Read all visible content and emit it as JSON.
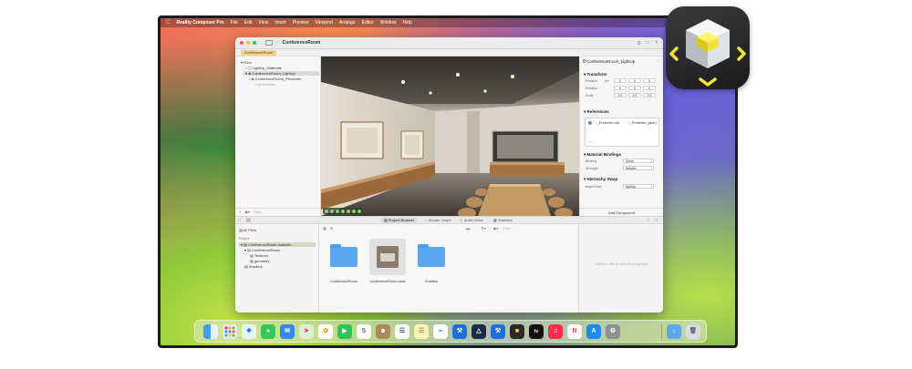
{
  "menubar": {
    "app_name": "Reality Composer Pro",
    "items": [
      "File",
      "Edit",
      "View",
      "Insert",
      "Preview",
      "Viewport",
      "Arrange",
      "Editor",
      "Window",
      "Help"
    ]
  },
  "window": {
    "title": "ConferenceRoom",
    "scene_tab": "ConferenceRoom"
  },
  "outline": {
    "items": [
      {
        "label": "Root"
      },
      {
        "label": "LightUp_Materials"
      },
      {
        "label": "ConferenceRoom_LightUp"
      },
      {
        "label": "ConferenceRoom_Presenter"
      },
      {
        "label": "LightHandler"
      }
    ],
    "filter_placeholder": "Filter"
  },
  "inspector": {
    "entity_name": "ConferenceRoom_LightUp",
    "transform": {
      "heading": "Transform",
      "position_label": "Position",
      "position_unit": "cm",
      "position": [
        "0",
        "0",
        "0"
      ],
      "rotation_label": "Rotation",
      "rotation": [
        "0",
        "0",
        "0"
      ],
      "scale_label": "Scale",
      "scale": [
        "0.0",
        "0.0",
        "0.0"
      ]
    },
    "references": {
      "heading": "References",
      "item1": "..._Presenter.usd",
      "item2": "..._Presenter_glow.j"
    },
    "material_bindings": {
      "heading": "Material Bindings",
      "binding_label": "Binding",
      "binding_value": "None",
      "strength_label": "Strength",
      "strength_value": "Weaker"
    },
    "hierarchy_swap": {
      "heading": "Hierarchy Swap",
      "target_label": "targetState",
      "target_value": "lightUp"
    },
    "add_component": "Add Component"
  },
  "bottom_tabs": [
    "Project Browser",
    "Shader Graph",
    "Audio Mixer",
    "Statistics"
  ],
  "project": {
    "all_files": "All Files",
    "section": "Project",
    "items": [
      {
        "label": "ConferenceRoom.rkassets"
      },
      {
        "label": "ConferenceRoom"
      },
      {
        "label": "Textures"
      },
      {
        "label": "geometry"
      },
      {
        "label": "Shaders"
      }
    ]
  },
  "files": {
    "filter_placeholder": "Filter",
    "tiles": [
      {
        "label": "ConferenceRoom",
        "icon": "folder-icon"
      },
      {
        "label": "ConferenceRoom.usda",
        "icon": "usd-file-icon"
      },
      {
        "label": "Shaders",
        "icon": "folder-icon"
      }
    ]
  },
  "preview": {
    "message": "Select a file to view its properties"
  },
  "dock": {
    "calendar_day": "5",
    "tv_label": "tv",
    "icons": [
      "finder-icon",
      "launchpad-icon",
      "safari-icon",
      "messages-icon",
      "mail-icon",
      "maps-icon",
      "photos-icon",
      "facetime-icon",
      "calendar-icon",
      "contacts-icon",
      "reminders-icon",
      "notes-icon",
      "freeform-icon",
      "xcode-icon",
      "instruments-icon",
      "simulator-icon",
      "reality-composer-pro-icon",
      "apple-tv-icon",
      "music-icon",
      "news-icon",
      "app-store-icon",
      "system-settings-icon",
      "downloads-icon",
      "trash-icon"
    ]
  },
  "colors": {
    "accent": "#f3d28a",
    "folder_blue": "#5aa9ef",
    "app_icon_cube": "#f4e23a"
  }
}
